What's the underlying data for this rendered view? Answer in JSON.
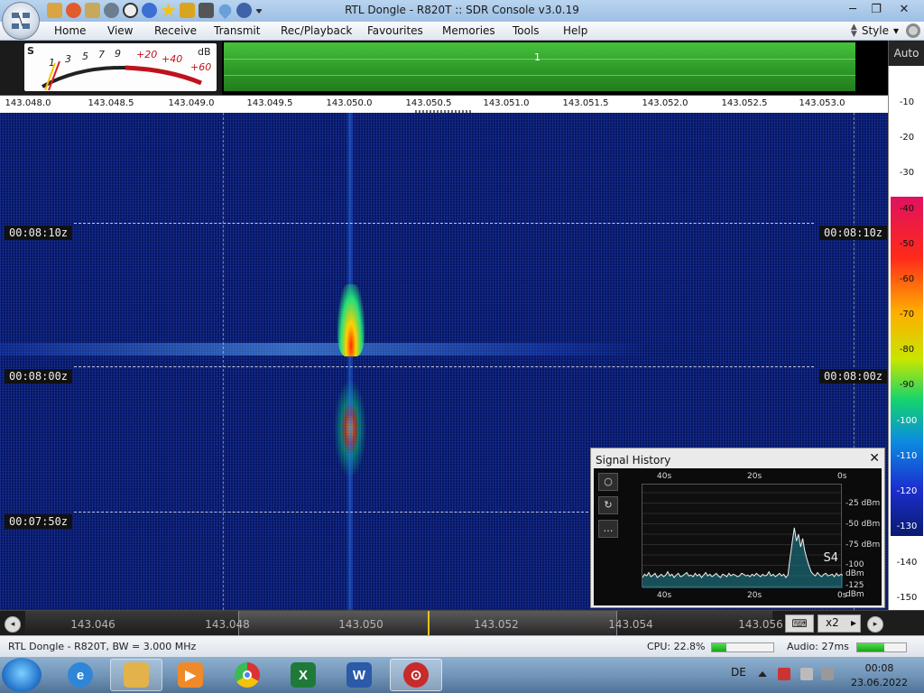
{
  "window": {
    "title": "RTL Dongle - R820T :: SDR Console v3.0.19",
    "minimize_glyph": "─",
    "maximize_glyph": "❐",
    "close_glyph": "✕"
  },
  "menu": {
    "items": [
      "Home",
      "View",
      "Receive",
      "Transmit",
      "Rec/Playback",
      "Favourites",
      "Memories",
      "Tools",
      "Help"
    ],
    "style_label": "Style",
    "style_arrow": "▾"
  },
  "smeter": {
    "s_label": "S",
    "db_label": "dB",
    "marks": [
      "1",
      "3",
      "5",
      "7",
      "9",
      "+20",
      "+40",
      "+60"
    ]
  },
  "bandbar": {
    "label": "1"
  },
  "auto_label": "Auto",
  "freq_scale": [
    "143.048.0",
    "143.048.5",
    "143.049.0",
    "143.049.5",
    "143.050.0",
    "143.050.5",
    "143.051.0",
    "143.051.5",
    "143.052.0",
    "143.052.5",
    "143.053.0"
  ],
  "db_scale": [
    "-10",
    "-20",
    "-30",
    "-40",
    "-50",
    "-60",
    "-70",
    "-80",
    "-90",
    "-100",
    "-110",
    "-120",
    "-130",
    "-140",
    "-150"
  ],
  "waterfall": {
    "time_labels": [
      "00:08:10z",
      "00:08:00z",
      "00:07:50z"
    ]
  },
  "signal_history": {
    "title": "Signal History",
    "close_glyph": "✕",
    "top_times": [
      "40s",
      "20s",
      "0s"
    ],
    "bottom_times": [
      "40s",
      "20s",
      "0s"
    ],
    "levels": [
      "-25 dBm",
      "-50 dBm",
      "-75 dBm",
      "-100 dBm",
      "-125 dBm"
    ],
    "s_value": "S4",
    "btn_more": "…",
    "history_dbm": [
      -122,
      -118,
      -120,
      -116,
      -121,
      -119,
      -117,
      -122,
      -120,
      -118,
      -121,
      -119,
      -115,
      -120,
      -118,
      -122,
      -119,
      -117,
      -121,
      -120,
      -118,
      -116,
      -120,
      -119,
      -121,
      -117,
      -120,
      -118,
      -122,
      -119,
      -116,
      -120,
      -118,
      -121,
      -119,
      -117,
      -120,
      -122,
      -118,
      -119,
      -121,
      -117,
      -120,
      -118,
      -119,
      -121,
      -120,
      -117,
      -118,
      -120,
      -119,
      -121,
      -118,
      -120,
      -117,
      -119,
      -121,
      -118,
      -120,
      -119,
      -115,
      -120,
      -118,
      -121,
      -119,
      -117,
      -120,
      -118,
      -122,
      -119,
      -98,
      -80,
      -62,
      -78,
      -70,
      -85,
      -75,
      -90,
      -100,
      -108,
      -115,
      -118,
      -120,
      -116,
      -119,
      -121,
      -118,
      -117,
      -120,
      -119,
      -118,
      -121,
      -117,
      -120,
      -118,
      -119
    ]
  },
  "tuning": {
    "ticks": [
      "143.046",
      "143.048",
      "143.050",
      "143.052",
      "143.054",
      "143.056"
    ],
    "keyboard_glyph": "⌨",
    "zoom_label": "x2",
    "zoom_arrow": "▸",
    "prev_glyph": "◂",
    "next_glyph": "▸"
  },
  "status": {
    "device": "RTL Dongle - R820T, BW = 3.000 MHz",
    "cpu_label": "CPU: 22.8%",
    "cpu_fraction": 0.228,
    "audio_label": "Audio: 27ms",
    "audio_fraction": 0.55
  },
  "taskbar": {
    "lang": "DE",
    "time": "00:08",
    "date": "23.06.2022",
    "apps": [
      "internet-explorer",
      "file-explorer",
      "media-player",
      "chrome",
      "excel",
      "word",
      "sdr-console"
    ],
    "excel_letter": "X",
    "word_letter": "W"
  },
  "colors": {
    "waterfall_bg": "#0a1a6e",
    "meter_red": "#c0121d",
    "band_green": "#2e9a28",
    "trace": "#f0f0f0",
    "peak_fill": "#1d7a8a"
  }
}
